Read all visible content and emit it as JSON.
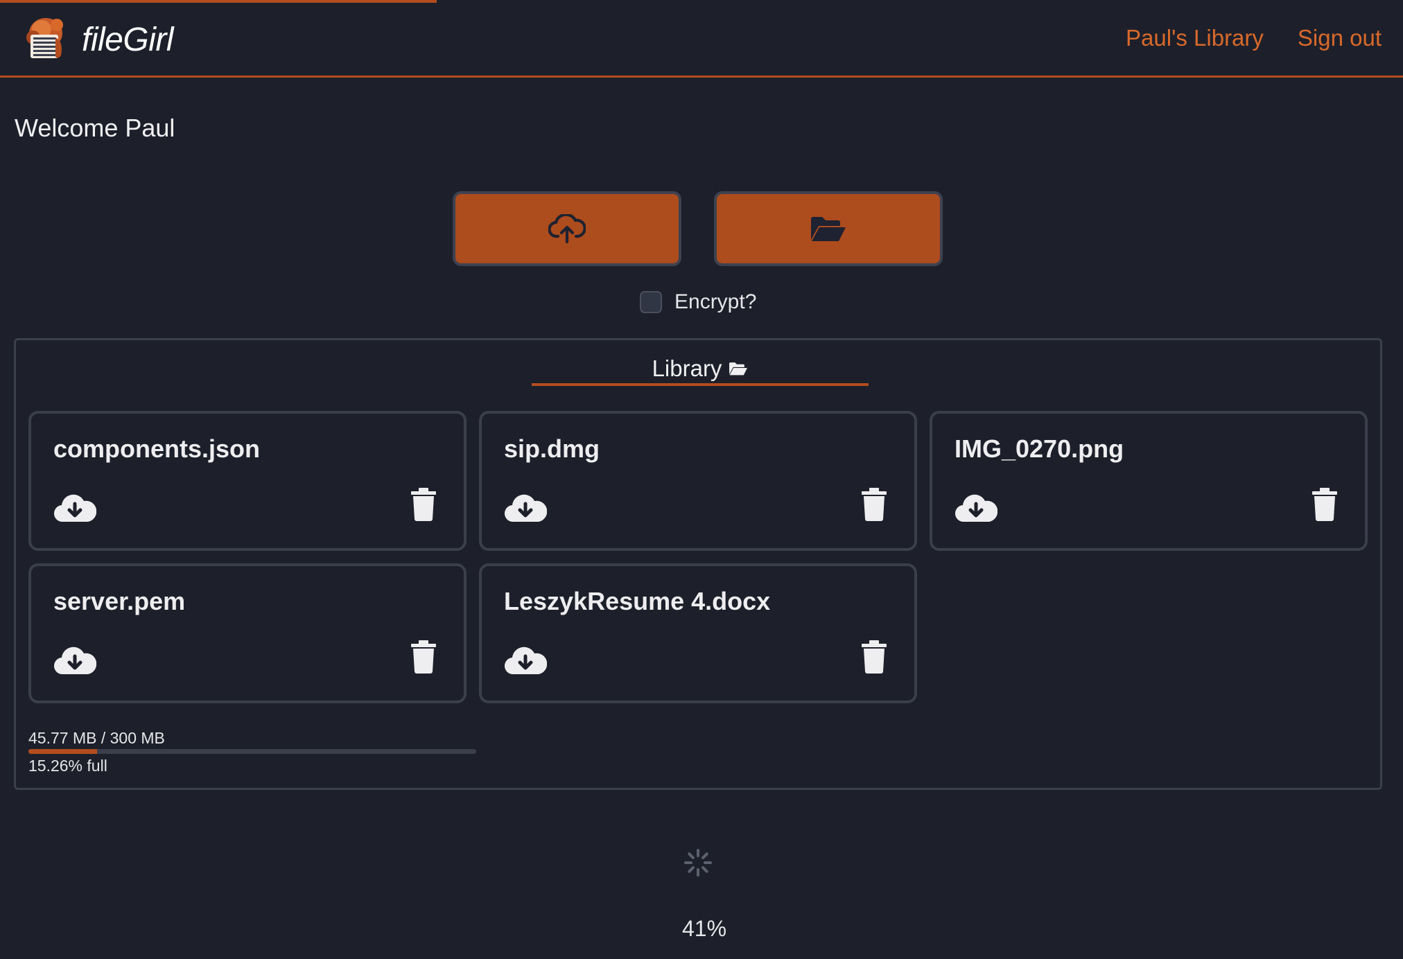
{
  "colors": {
    "background": "#1d202a",
    "accent": "#b34d1e",
    "link": "#d9692b",
    "card_border": "#3b3f4c",
    "text": "#e9e9ec"
  },
  "top_progress_fraction": 0.41,
  "nav": {
    "brand": "fileGirl",
    "logo_icon": "filegirl-logo",
    "links": [
      "Paul's Library",
      "Sign out"
    ]
  },
  "welcome": "Welcome Paul",
  "actions": {
    "upload_icon": "cloud-upload-icon",
    "folder_icon": "folder-open-icon"
  },
  "encrypt": {
    "label": "Encrypt?",
    "checked": false
  },
  "library": {
    "title": "Library",
    "title_icon": "folder-open-icon",
    "files": [
      {
        "name": "components.json"
      },
      {
        "name": "sip.dmg"
      },
      {
        "name": "IMG_0270.png"
      },
      {
        "name": "server.pem"
      },
      {
        "name": "LeszykResume 4.docx"
      }
    ],
    "file_actions": {
      "download_icon": "cloud-download-icon",
      "delete_icon": "trash-icon"
    },
    "storage": {
      "usage": "45.77 MB / 300 MB",
      "full_text": "15.26% full",
      "fraction": 0.1526
    }
  },
  "upload_progress": {
    "spinner_icon": "spinner-icon",
    "percent": "41%"
  }
}
